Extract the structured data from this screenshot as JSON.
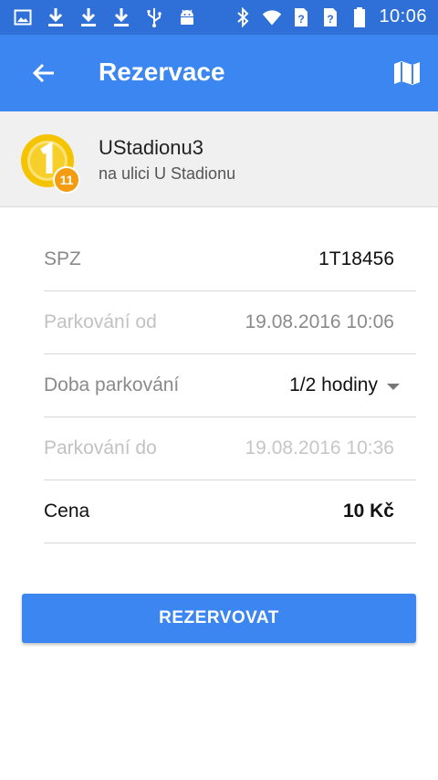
{
  "status_bar": {
    "time": "10:06",
    "left_icons": [
      "image-icon",
      "download-icon",
      "download-icon",
      "download-icon",
      "usb-icon",
      "android-icon"
    ],
    "right_icons": [
      "bluetooth-icon",
      "wifi-icon",
      "no-sim-icon",
      "no-sim-icon",
      "battery-icon"
    ]
  },
  "app_bar": {
    "title": "Rezervace",
    "back_icon": "arrow-back-icon",
    "map_icon": "map-icon"
  },
  "lot": {
    "name": "UStadionu3",
    "street": "na ulici U Stadionu",
    "badge": "11",
    "icon": "coin-1-icon"
  },
  "form": {
    "spz": {
      "label": "SPZ",
      "value": "1T18456"
    },
    "start": {
      "label": "Parkování od",
      "value": "19.08.2016 10:06"
    },
    "duration": {
      "label": "Doba parkování",
      "value": "1/2 hodiny"
    },
    "end": {
      "label": "Parkování do",
      "value": "19.08.2016 10:36"
    },
    "price": {
      "label": "Cena",
      "value": "10 Kč"
    }
  },
  "actions": {
    "reserve_label": "REZERVOVAT"
  },
  "colors": {
    "status_bar": "#2f6fd8",
    "app_bar": "#3b86f0",
    "button": "#3b86f0",
    "badge": "#f39c12",
    "coin": "#f5c400"
  }
}
